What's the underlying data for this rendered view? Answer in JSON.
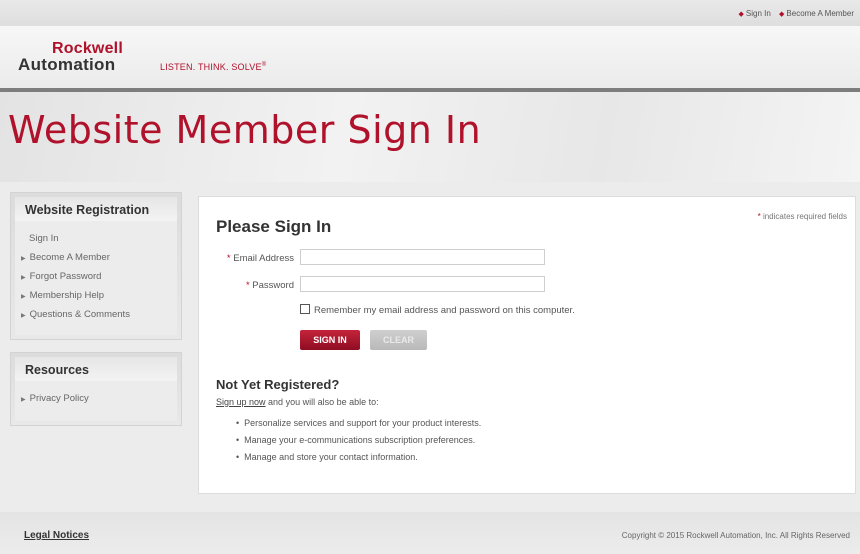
{
  "toplinks": {
    "sign_in": "Sign In",
    "become_member": "Become A Member"
  },
  "header": {
    "logo_line1": "Rockwell",
    "logo_line2": "Automation",
    "tagline": "LISTEN. THINK. SOLVE"
  },
  "banner": {
    "title": "Website Member Sign In"
  },
  "sidebar": {
    "registration_title": "Website Registration",
    "registration_items": [
      "Sign In",
      "Become A Member",
      "Forgot Password",
      "Membership Help",
      "Questions & Comments"
    ],
    "resources_title": "Resources",
    "resources_items": [
      "Privacy Policy"
    ]
  },
  "form": {
    "required_note": "indicates required fields",
    "title": "Please Sign In",
    "email_label": "Email Address",
    "email_value": "",
    "password_label": "Password",
    "password_value": "",
    "remember_label": "Remember my email address and password on this computer.",
    "signin_button": "SIGN IN",
    "clear_button": "CLEAR"
  },
  "register": {
    "title": "Not Yet Registered?",
    "signup_link": "Sign up now",
    "signup_text": " and you will also be able to:",
    "benefits": [
      "Personalize services and support for your product interests.",
      "Manage your e-communications subscription preferences.",
      "Manage and store your contact information."
    ]
  },
  "footer": {
    "legal": "Legal Notices",
    "copyright": "Copyright © 2015 Rockwell Automation, Inc. All Rights Reserved"
  },
  "colors": {
    "brand": "#b0112b",
    "button_primary": "#a8152d",
    "button_disabled": "#c4c4c4"
  }
}
